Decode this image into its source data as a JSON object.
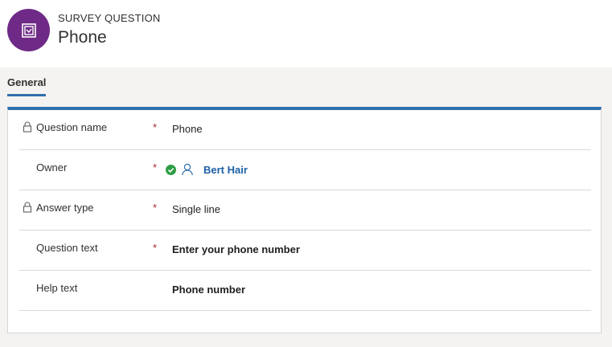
{
  "header": {
    "entity_type": "SURVEY QUESTION",
    "title": "Phone",
    "avatar_icon": "survey-question-icon",
    "avatar_color": "#6e2a86"
  },
  "tabs": [
    {
      "label": "General",
      "active": true
    }
  ],
  "accent_color": "#2f6fad",
  "form": {
    "fields": [
      {
        "label": "Question name",
        "required": "*",
        "value": "Phone",
        "locked": true
      },
      {
        "label": "Owner",
        "required": "*",
        "value": "Bert Hair",
        "locked": false,
        "status_icon": "check-circle-icon",
        "person_icon": "person-icon"
      },
      {
        "label": "Answer type",
        "required": "*",
        "value": "Single line",
        "locked": true
      },
      {
        "label": "Question text",
        "required": "*",
        "value": "Enter your phone number",
        "locked": false
      },
      {
        "label": "Help text",
        "required": "",
        "value": "Phone number",
        "locked": false
      }
    ]
  }
}
